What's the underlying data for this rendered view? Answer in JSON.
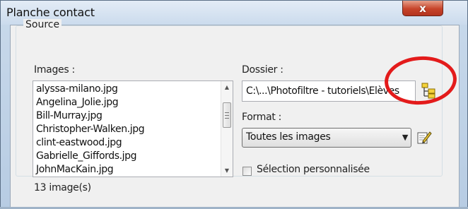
{
  "window": {
    "title": "Planche contact",
    "close_label": "x"
  },
  "source": {
    "group_label": "Source",
    "images_label": "Images :",
    "images": [
      "alyssa-milano.jpg",
      "Angelina_Jolie.jpg",
      "Bill-Murray.jpg",
      "Christopher-Walken.jpg",
      "clint-eastwood.jpg",
      "Gabrielle_Giffords.jpg",
      "JohnMacKain.jpg"
    ],
    "image_count": "13 image(s)",
    "folder_label": "Dossier :",
    "folder_value": "C:\\...\\Photofiltre - tutoriels\\Elèves",
    "format_label": "Format :",
    "format_value": "Toutes les images",
    "custom_selection_label": "Sélection personnalisée",
    "custom_selection_checked": false
  },
  "icons": {
    "browse": "folder-tree-icon",
    "edit": "pencil-edit-icon"
  },
  "colors": {
    "annotation": "#e31b1b",
    "close_button": "#c7442a"
  }
}
